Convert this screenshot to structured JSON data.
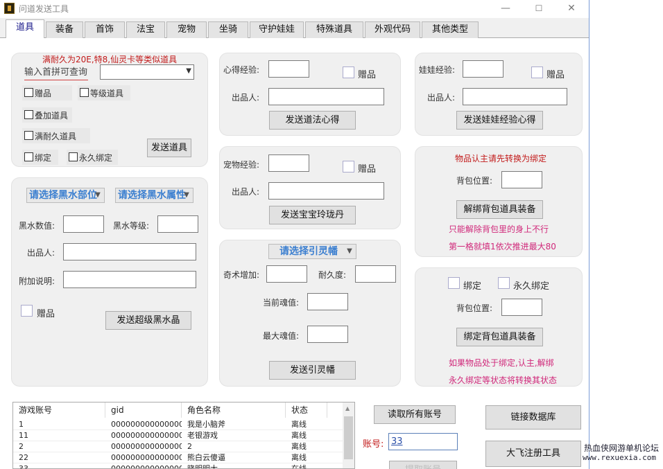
{
  "window": {
    "title": "问道发送工具",
    "min": "—",
    "max": "☐",
    "close": "✕"
  },
  "tabs": [
    "道具",
    "装备",
    "首饰",
    "法宝",
    "宠物",
    "坐骑",
    "守护娃娃",
    "特殊道具",
    "外观代码",
    "其他类型"
  ],
  "item_panel": {
    "notice": "满耐久为20E,特8,仙灵卡等类似道具",
    "search_label": "输入首拼可查询",
    "cb_gift": "赠品",
    "cb_level": "等级道具",
    "cb_stack": "叠加道具",
    "cb_full": "满耐久道具",
    "cb_bind": "绑定",
    "cb_perm": "永久绑定",
    "send_btn": "发送道具"
  },
  "black_panel": {
    "part_sel": "请选择黑水部位",
    "attr_sel": "请选择黑水属性",
    "value_label": "黑水数值:",
    "level_label": "黑水等级:",
    "maker_label": "出品人:",
    "note_label": "附加说明:",
    "gift": "赠品",
    "send_btn": "发送超级黑水晶"
  },
  "heart_panel": {
    "exp_label": "心得经验:",
    "gift": "赠品",
    "maker_label": "出品人:",
    "send_btn": "发送道法心得"
  },
  "pet_panel": {
    "exp_label": "宠物经验:",
    "gift": "赠品",
    "maker_label": "出品人:",
    "send_btn": "发送宝宝玲珑丹"
  },
  "soul_panel": {
    "sel": "请选择引灵幡",
    "add_label": "奇术增加:",
    "dur_label": "耐久度:",
    "cur_label": "当前魂值:",
    "max_label": "最大魂值:",
    "send_btn": "发送引灵幡"
  },
  "doll_panel": {
    "exp_label": "娃娃经验:",
    "gift": "赠品",
    "maker_label": "出品人:",
    "send_btn": "发送娃娃经验心得"
  },
  "unbind_panel": {
    "notice": "物品认主请先转换为绑定",
    "pos_label": "背包位置:",
    "btn": "解绑背包道具装备",
    "tip1": "只能解除背包里的身上不行",
    "tip2": "第一格就填1依次推进最大80"
  },
  "bind_panel": {
    "cb_bind": "绑定",
    "cb_perm": "永久绑定",
    "pos_label": "背包位置:",
    "btn": "绑定背包道具装备",
    "tip1": "如果物品处于绑定,认主,解绑",
    "tip2": "永久绑定等状态将转换其状态"
  },
  "accounts": {
    "headers": [
      "游戏账号",
      "gid",
      "角色名称",
      "状态"
    ],
    "rows": [
      [
        "1",
        "0000000000000003",
        "我是小脑斧",
        "离线"
      ],
      [
        "11",
        "0000000000000007",
        "老银游戏",
        "离线"
      ],
      [
        "2",
        "0000000000000004",
        "2",
        "离线"
      ],
      [
        "22",
        "0000000000000008",
        "熊白云傻逼",
        "离线"
      ],
      [
        "33",
        "0000000000000009",
        "晓明明大",
        "在线"
      ]
    ]
  },
  "side": {
    "read_btn": "读取所有账号",
    "acct_label": "账号:",
    "acct_value": "33",
    "link_btn": "链接数据库",
    "reg_btn": "大飞注册工具",
    "hidden_btn": "提取账号"
  },
  "watermark": {
    "line1": "热血侠网游单机论坛",
    "line2": "www.rexuexia.com"
  }
}
